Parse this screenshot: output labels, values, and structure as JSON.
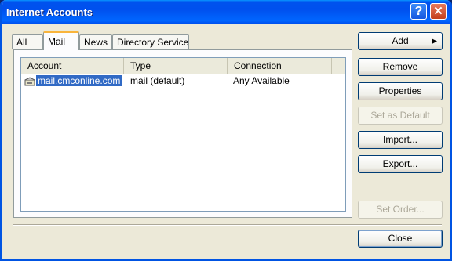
{
  "window": {
    "title": "Internet Accounts",
    "help_glyph": "?",
    "close_glyph": "✕"
  },
  "tabs": [
    {
      "label": "All"
    },
    {
      "label": "Mail"
    },
    {
      "label": "News"
    },
    {
      "label": "Directory Service"
    }
  ],
  "active_tab": "Mail",
  "list": {
    "columns": [
      "Account",
      "Type",
      "Connection"
    ],
    "rows": [
      {
        "account": "mail.cmconline.com",
        "type": "mail (default)",
        "connection": "Any Available",
        "icon": "mail-account-icon",
        "selected": true
      }
    ]
  },
  "buttons": {
    "add": "Add",
    "add_arrow": "▶",
    "remove": "Remove",
    "properties": "Properties",
    "set_default": "Set as Default",
    "import": "Import...",
    "export": "Export...",
    "set_order": "Set Order...",
    "close": "Close"
  },
  "colors": {
    "titlebar": "#0054e3",
    "selection": "#316ac5",
    "tab_highlight": "#f9b43b"
  }
}
